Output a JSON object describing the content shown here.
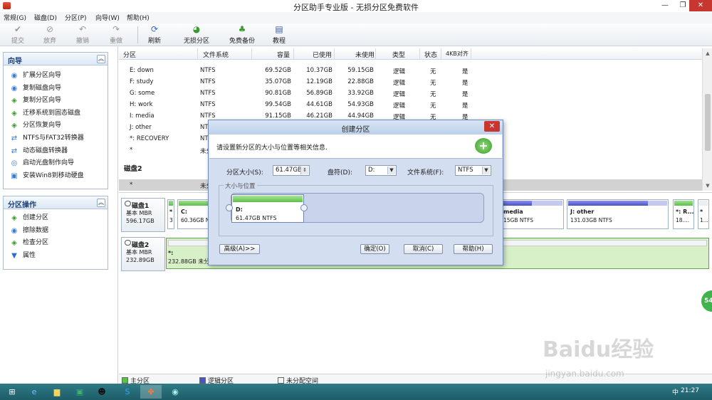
{
  "window": {
    "title": "分区助手专业版 - 无损分区免费软件"
  },
  "menu": [
    "常规(G)",
    "磁盘(D)",
    "分区(P)",
    "向导(W)",
    "帮助(H)"
  ],
  "toolbar": {
    "submit": "提交",
    "discard": "放弃",
    "undo": "撤销",
    "redo": "重做",
    "refresh": "刷新",
    "lossless": "无损分区",
    "backup": "免费备份",
    "tutorial": "教程"
  },
  "wizard_panel": {
    "title": "向导",
    "items": [
      "扩展分区向导",
      "复制磁盘向导",
      "复制分区向导",
      "迁移系统到固态磁盘",
      "分区恢复向导",
      "NTFS与FAT32转换器",
      "动态磁盘转换器",
      "启动光盘制作向导",
      "安装Win8到移动硬盘"
    ]
  },
  "partition_panel": {
    "title": "分区操作",
    "items": [
      "创建分区",
      "擦除数据",
      "检查分区",
      "属性"
    ]
  },
  "columns": [
    "分区",
    "文件系统",
    "容量",
    "已使用",
    "未使用",
    "类型",
    "状态",
    "4KB对齐"
  ],
  "rows": [
    {
      "name": "E: down",
      "fs": "NTFS",
      "cap": "69.52GB",
      "used": "10.37GB",
      "free": "59.15GB",
      "type": "逻辑",
      "status": "无",
      "align": "是"
    },
    {
      "name": "F: study",
      "fs": "NTFS",
      "cap": "35.07GB",
      "used": "12.19GB",
      "free": "22.88GB",
      "type": "逻辑",
      "status": "无",
      "align": "是"
    },
    {
      "name": "G: some",
      "fs": "NTFS",
      "cap": "90.81GB",
      "used": "56.89GB",
      "free": "33.92GB",
      "type": "逻辑",
      "status": "无",
      "align": "是"
    },
    {
      "name": "H: work",
      "fs": "NTFS",
      "cap": "99.54GB",
      "used": "44.61GB",
      "free": "54.93GB",
      "type": "逻辑",
      "status": "无",
      "align": "是"
    },
    {
      "name": "I: media",
      "fs": "NTFS",
      "cap": "91.15GB",
      "used": "46.21GB",
      "free": "44.94GB",
      "type": "逻辑",
      "status": "无",
      "align": "是"
    },
    {
      "name": "J: other",
      "fs": "NTI",
      "cap": "",
      "used": "",
      "free": "",
      "type": "",
      "status": "",
      "align": ""
    },
    {
      "name": "*: RECOVERY",
      "fs": "NTI",
      "cap": "",
      "used": "",
      "free": "",
      "type": "",
      "status": "",
      "align": ""
    },
    {
      "name": "*",
      "fs": "未分",
      "cap": "",
      "used": "",
      "free": "",
      "type": "",
      "status": "",
      "align": ""
    }
  ],
  "disk2_group": {
    "label": "磁盘2",
    "row_name": "*",
    "row_fs": "未分"
  },
  "disks": {
    "d1": {
      "name": "磁盘1",
      "type": "基本 MBR",
      "size": "596.17GB"
    },
    "d2": {
      "name": "磁盘2",
      "type": "基本 MBR",
      "size": "232.89GB"
    }
  },
  "disk1_parts": {
    "p0": {
      "label": "*",
      "size": "3"
    },
    "c": {
      "label": "C:",
      "size": "60.36GB NTFS"
    },
    "media": {
      "label": "media",
      "size": "15GB NTFS"
    },
    "other": {
      "label": "J: other",
      "size": "131.03GB NTFS"
    },
    "rec": {
      "label": "*: R...",
      "size": "18...."
    },
    "tail": {
      "label": "*",
      "size": "1..."
    }
  },
  "disk2_part": {
    "label": "*:",
    "size": "232.88GB 未分"
  },
  "legend": {
    "primary": "主分区",
    "logical": "逻辑分区",
    "unallocated": "未分配空间"
  },
  "dialog": {
    "title": "创建分区",
    "info": "请设置新分区的大小与位置等相关信息.",
    "size_label": "分区大小(S):",
    "size_value": "61.47GB",
    "drive_label": "盘符(D):",
    "drive_value": "D:",
    "fs_label": "文件系统(F):",
    "fs_value": "NTFS",
    "group_label": "大小与位置",
    "part_label": "D:",
    "part_size": "61.47GB NTFS",
    "btn_advanced": "高级(A)>>",
    "btn_ok": "确定(O)",
    "btn_cancel": "取消(C)",
    "btn_help": "帮助(H)"
  },
  "side_badge": "54",
  "watermark": {
    "main": "Baidu经验",
    "sub": "jingyan.baidu.com"
  },
  "taskbar": {
    "tray": "中",
    "clock": "21:27"
  }
}
